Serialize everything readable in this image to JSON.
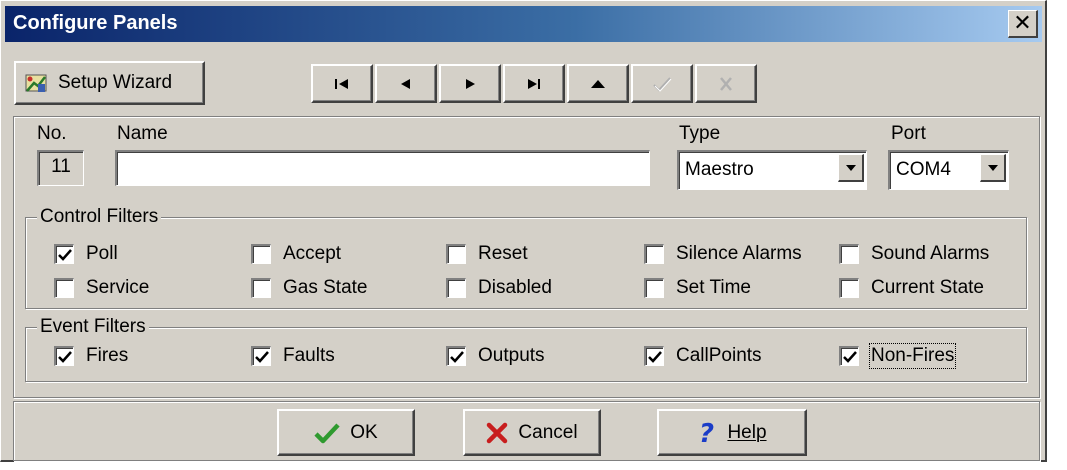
{
  "window": {
    "title": "Configure Panels",
    "close_label": "✕"
  },
  "toolbar": {
    "wizard_label": "Setup Wizard",
    "nav": [
      "first-record",
      "previous-record",
      "next-record",
      "last-record",
      "insert-record",
      "post-edit",
      "cancel-edit"
    ]
  },
  "fields": {
    "no_label": "No.",
    "no_value": "11",
    "name_label": "Name",
    "name_value": "",
    "type_label": "Type",
    "type_value": "Maestro",
    "port_label": "Port",
    "port_value": "COM4"
  },
  "control_filters": {
    "title": "Control Filters",
    "items": [
      {
        "label": "Poll",
        "checked": true
      },
      {
        "label": "Accept",
        "checked": false
      },
      {
        "label": "Reset",
        "checked": false
      },
      {
        "label": "Silence Alarms",
        "checked": false
      },
      {
        "label": "Sound Alarms",
        "checked": false
      },
      {
        "label": "Service",
        "checked": false
      },
      {
        "label": "Gas State",
        "checked": false
      },
      {
        "label": "Disabled",
        "checked": false
      },
      {
        "label": "Set Time",
        "checked": false
      },
      {
        "label": "Current State",
        "checked": false
      }
    ]
  },
  "event_filters": {
    "title": "Event Filters",
    "items": [
      {
        "label": "Fires",
        "checked": true
      },
      {
        "label": "Faults",
        "checked": true
      },
      {
        "label": "Outputs",
        "checked": true
      },
      {
        "label": "CallPoints",
        "checked": true
      },
      {
        "label": "Non-Fires",
        "checked": true
      }
    ]
  },
  "buttons": {
    "ok": "OK",
    "cancel": "Cancel",
    "help": "Help"
  },
  "colors": {
    "title_start": "#0a246a",
    "title_end": "#a6caf0",
    "face": "#d4d0c8",
    "ok_check": "#2f9a2f",
    "cancel_x": "#c81e1e",
    "help_q": "#1a3cc8"
  }
}
